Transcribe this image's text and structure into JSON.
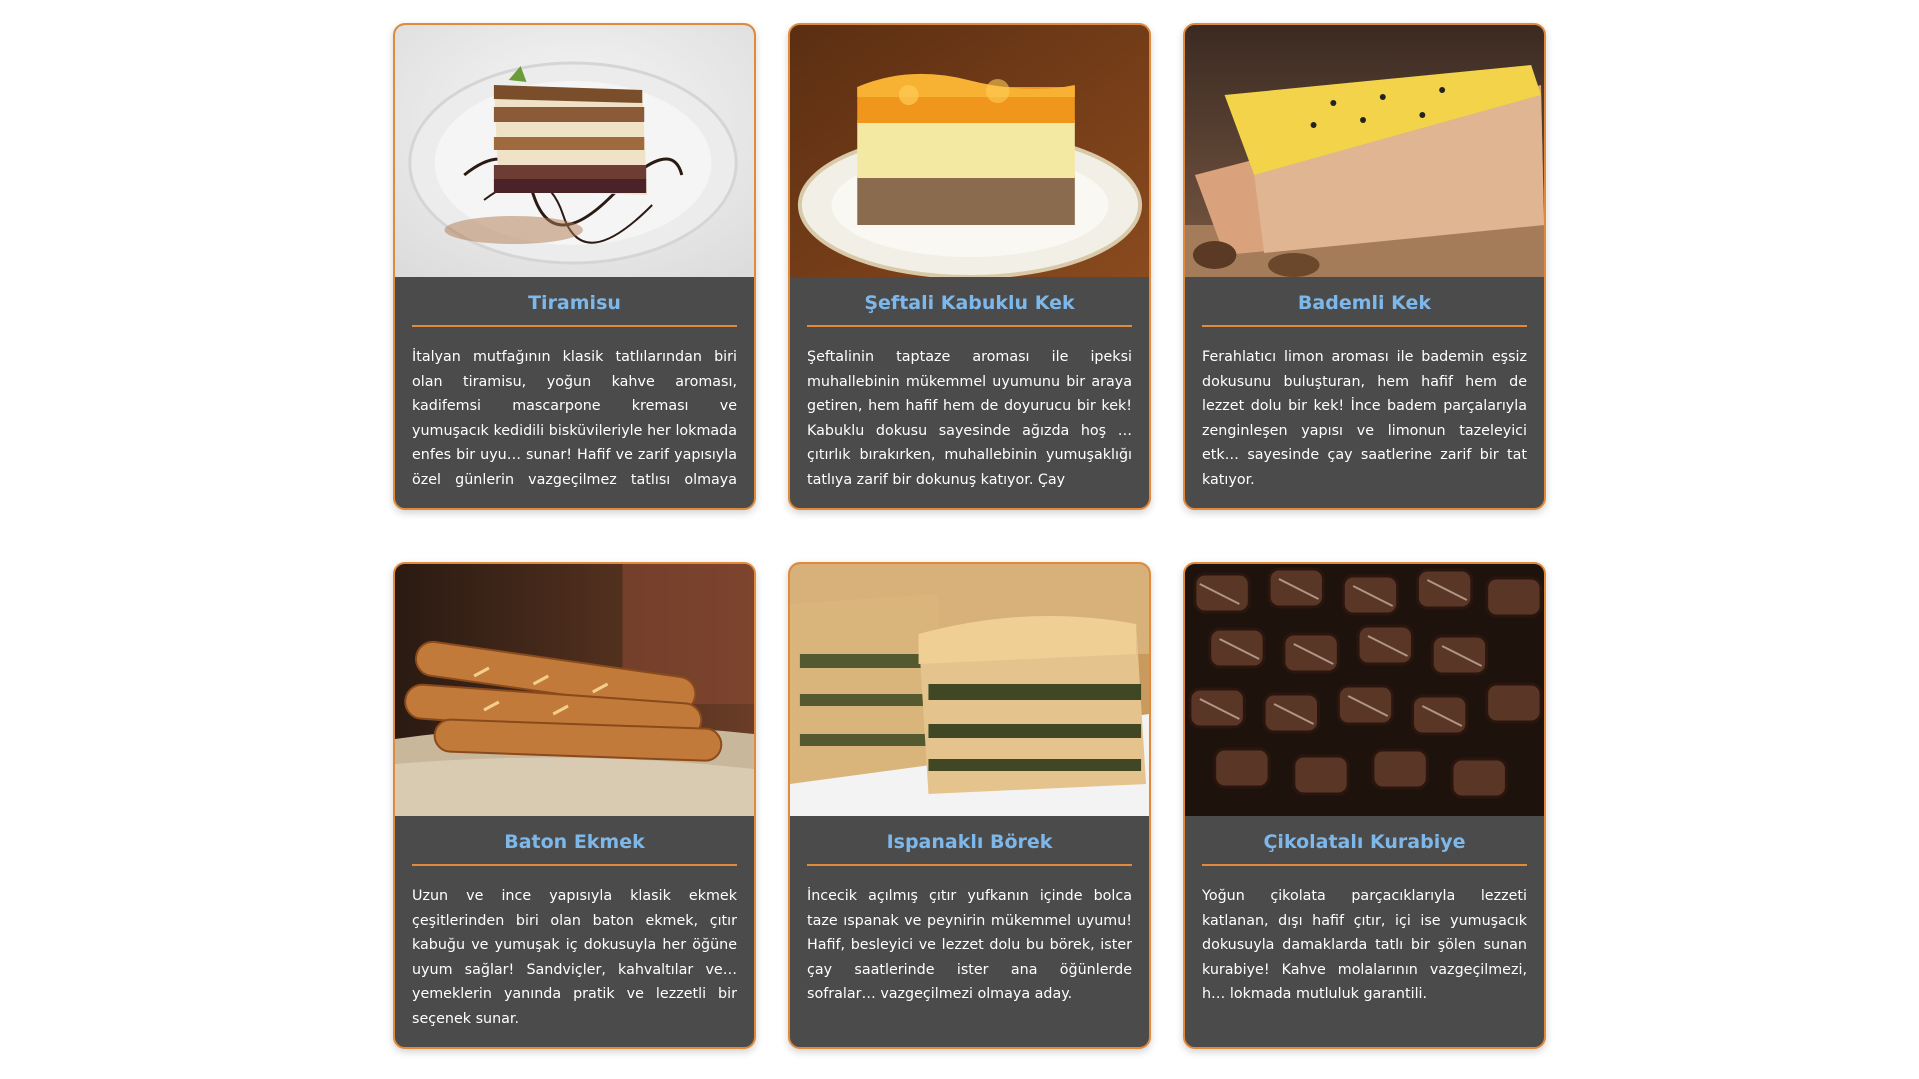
{
  "cards": [
    {
      "title": "Tiramisu",
      "text": "İtalyan mutfağının klasik tatlılarından biri olan tiramisu, yoğun kahve aroması, kadifemsi mascarpone kreması ve yumuşacık kedidili bisküvileriyle her lokmada enfes bir uyu… sunar! Hafif ve zarif yapısıyla özel günlerin vazgeçilmez tatlısı olmaya aday.",
      "image_icon": "tiramisu-image"
    },
    {
      "title": "Şeftali Kabuklu Kek",
      "text": "Şeftalinin taptaze aroması ile ipeksi muhallebinin mükemmel uyumunu bir araya getiren, hem hafif hem de doyurucu bir kek! Kabuklu dokusu sayesinde ağızda hoş … çıtırlık bırakırken, muhallebinin yumuşaklığı tatlıya zarif bir dokunuş katıyor. Çay",
      "image_icon": "peach-cake-image"
    },
    {
      "title": "Bademli Kek",
      "text": "Ferahlatıcı limon aroması ile bademin eşsiz dokusunu buluşturan, hem hafif hem de lezzet dolu bir kek! İnce badem parçalarıyla zenginleşen yapısı ve limonun tazeleyici etk… sayesinde çay saatlerine zarif bir tat katıyor.",
      "image_icon": "almond-cake-image"
    },
    {
      "title": "Baton Ekmek",
      "text": "Uzun ve ince yapısıyla klasik ekmek çeşitlerinden biri olan baton ekmek, çıtır kabuğu ve yumuşak iç dokusuyla her öğüne uyum sağlar! Sandviçler, kahvaltılar ve… yemeklerin yanında pratik ve lezzetli bir seçenek sunar.",
      "image_icon": "baguette-image"
    },
    {
      "title": "Ispanaklı Börek",
      "text": "İncecik açılmış çıtır yufkanın içinde bolca taze ıspanak ve peynirin mükemmel uyumu! Hafif, besleyici ve lezzet dolu bu börek, ister çay saatlerinde ister ana öğünlerde sofralar… vazgeçilmezi olmaya aday.",
      "image_icon": "spinach-borek-image"
    },
    {
      "title": "Çikolatalı Kurabiye",
      "text": "Yoğun çikolata parçacıklarıyla lezzeti katlanan, dışı hafif çıtır, içi ise yumuşacık dokusuyla damaklarda tatlı bir şölen sunan kurabiye! Kahve molalarının vazgeçilmezi, h… lokmada mutluluk garantili.",
      "image_icon": "chocolate-cookies-image"
    }
  ],
  "colors": {
    "card_bg": "#4b4b4b",
    "border": "#e28a3b",
    "title": "#7eb8ea",
    "text": "#ffffff"
  }
}
